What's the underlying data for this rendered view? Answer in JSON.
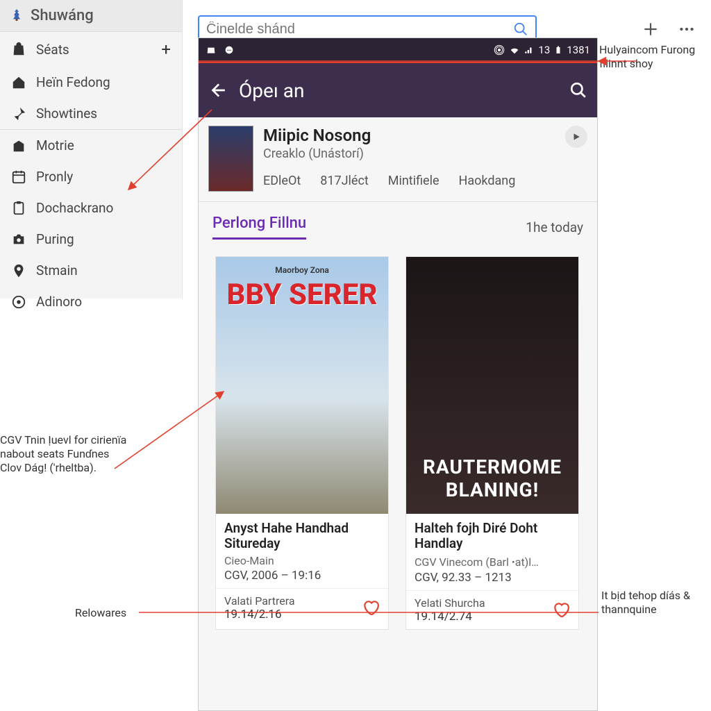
{
  "sidebar": {
    "title": "Shuwáng",
    "items": [
      {
        "label": "Séats",
        "plus": true
      },
      {
        "label": "Heïn Fedong"
      },
      {
        "label": "Showtines"
      },
      {
        "label": "Motrie",
        "sep": true
      },
      {
        "label": "Pronly"
      },
      {
        "label": "Dochackrano"
      },
      {
        "label": "Puring"
      },
      {
        "label": "Stmain"
      },
      {
        "label": "Adinoro"
      }
    ]
  },
  "search": {
    "placeholder": "Ĉinelde shánd"
  },
  "statusbar": {
    "num": "13",
    "time": "1381"
  },
  "appbar": {
    "title": "Ópeı an"
  },
  "featured": {
    "title": "Miipic Nosong",
    "subtitle": "Creaklo (Unástorí)",
    "tabs": [
      "EDleOt",
      "817Jléct",
      "Mintifiele",
      "Haokdang"
    ]
  },
  "section": {
    "tab": "Perlong Fillnu",
    "right": "1he today"
  },
  "cards": [
    {
      "poster_top": "Maorboy Zona",
      "poster_title": "BBY SERER",
      "title": "Anyst Hahe Handhad Situreday",
      "location": "Cieo-Main",
      "time": "CGV, 2006 – 19:16",
      "foot_label": "Valati Partrera",
      "rating": "19.14/2:16"
    },
    {
      "poster_sub": "RAUTERMOME BLANING!",
      "title": "Halteh fojh Diré Doht Handlay",
      "location": "CGV Vinecom (Barl ꞏat)l…",
      "time": "CGV, 92.33 – 1213",
      "foot_label": "Yelati Shurcha",
      "rating": "19.14/2.74"
    }
  ],
  "bottom_label": "Relowares",
  "annotations": {
    "left": "CGV Tnin Ịueνl for cirienïa nabout seats Funɗnes Clov Dág! ('rheltba).",
    "top_right": "Hulyaincom Furong fllinnt shoy",
    "bottom_right": "It bịd tehop díás & thannquine"
  }
}
